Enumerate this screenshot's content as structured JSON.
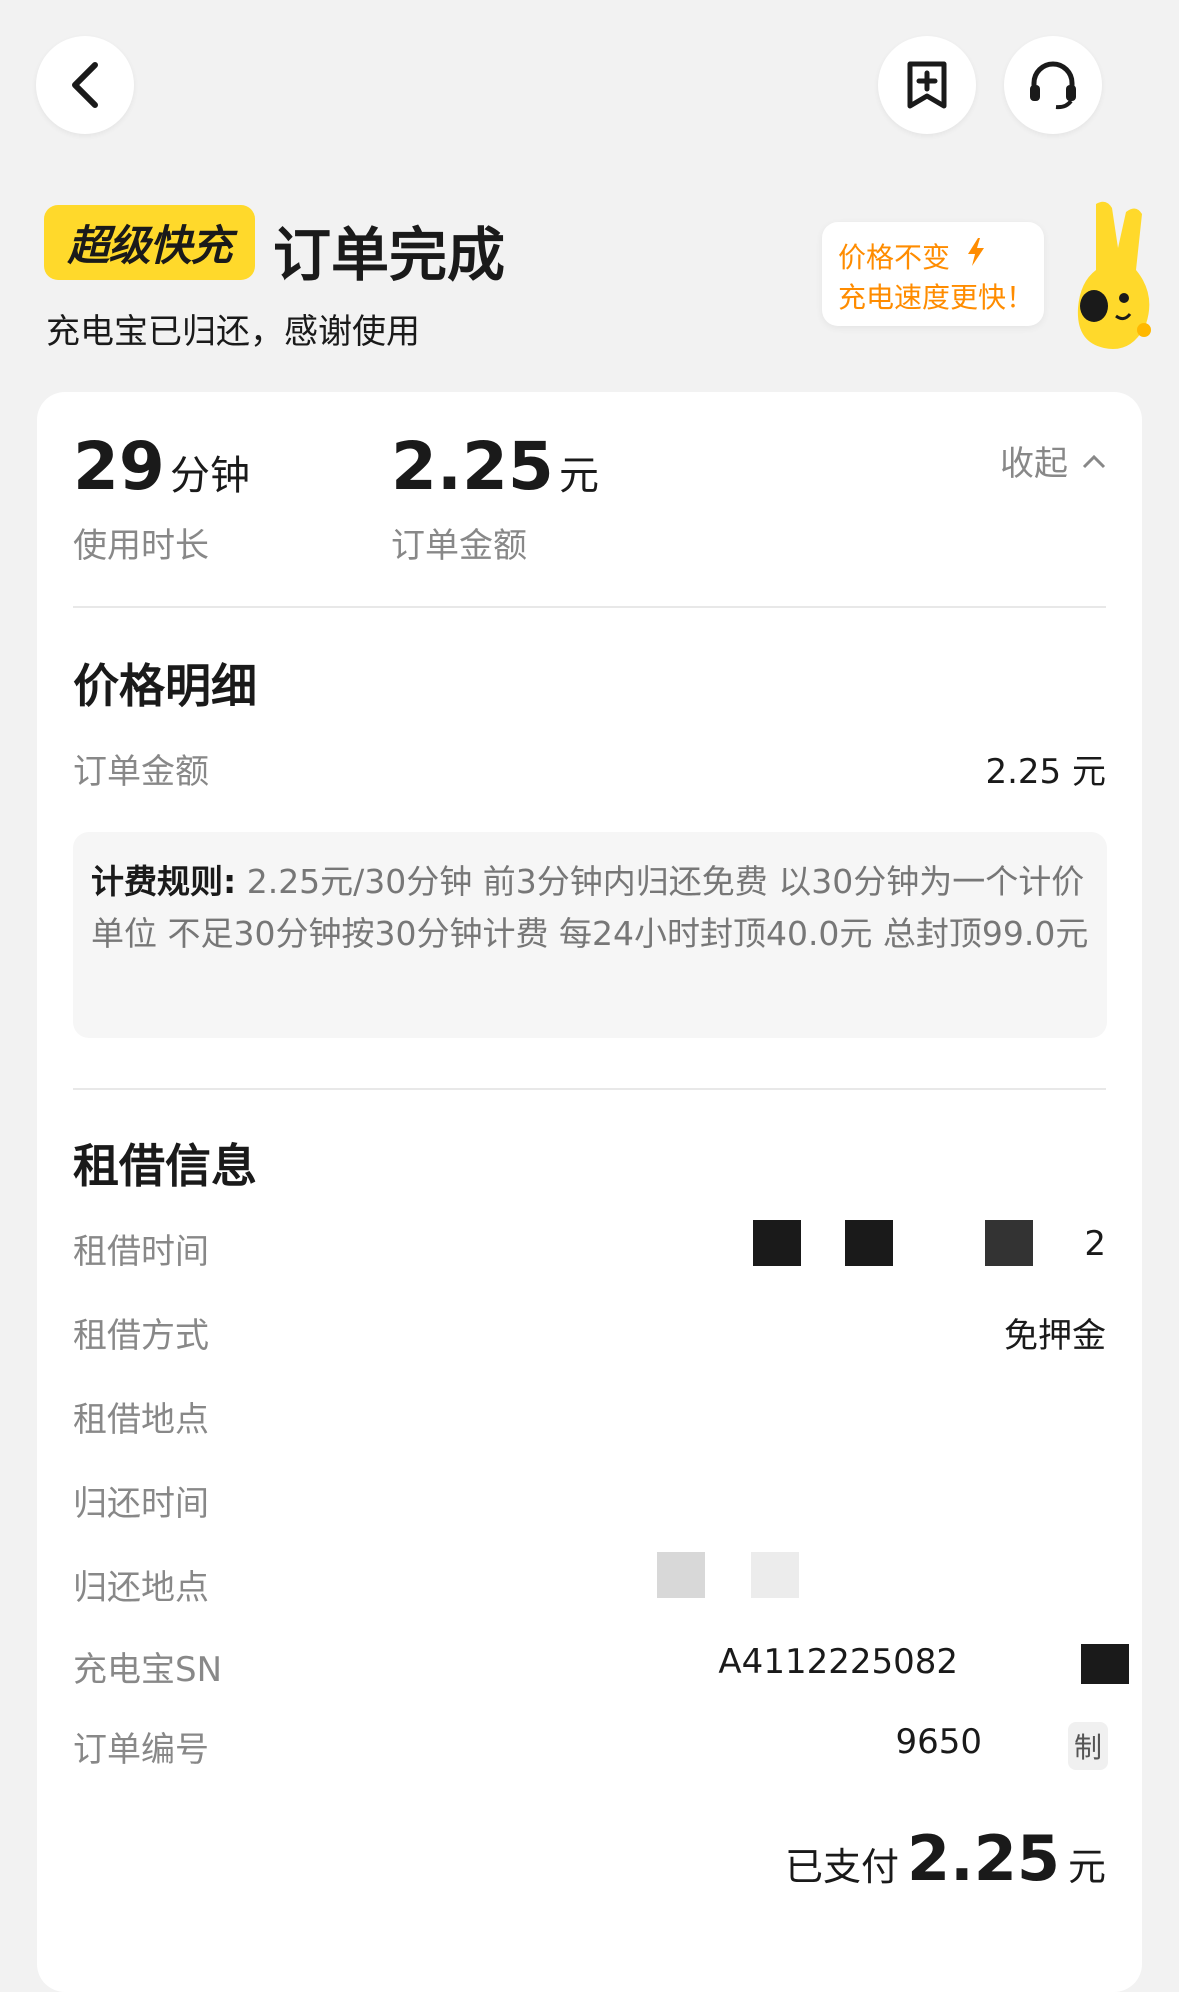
{
  "header": {
    "brand_badge": "超级快充",
    "title": "订单完成",
    "subtitle": "充电宝已归还，感谢使用"
  },
  "promo": {
    "line1": "价格不变",
    "line2": "充电速度更快！"
  },
  "summary": {
    "duration_value": "29",
    "duration_unit": "分钟",
    "duration_label": "使用时长",
    "amount_value": "2.25",
    "amount_unit": "元",
    "amount_label": "订单金额",
    "collapse_label": "收起"
  },
  "price_detail": {
    "title": "价格明细",
    "order_amount_label": "订单金额",
    "order_amount_value": "2.25 元",
    "rules_title": "计费规则:",
    "rules_text": "2.25元/30分钟 前3分钟内归还免费 以30分钟为一个计价单位 不足30分钟按30分钟计费 每24小时封顶40.0元 总封顶99.0元"
  },
  "rental_info": {
    "title": "租借信息",
    "rows": [
      {
        "label": "租借时间",
        "value": "2"
      },
      {
        "label": "租借方式",
        "value": "免押金"
      },
      {
        "label": "租借地点",
        "value": ""
      },
      {
        "label": "归还时间",
        "value": ""
      },
      {
        "label": "归还地点",
        "value": ""
      },
      {
        "label": "充电宝SN",
        "value": "A4112225082"
      },
      {
        "label": "订单编号",
        "value": "9650"
      }
    ],
    "copy_label": "制"
  },
  "payment": {
    "label": "已支付",
    "amount": "2.25",
    "unit": "元"
  },
  "colors": {
    "brand_yellow": "#ffd92b",
    "promo_orange": "#ff8c00"
  }
}
